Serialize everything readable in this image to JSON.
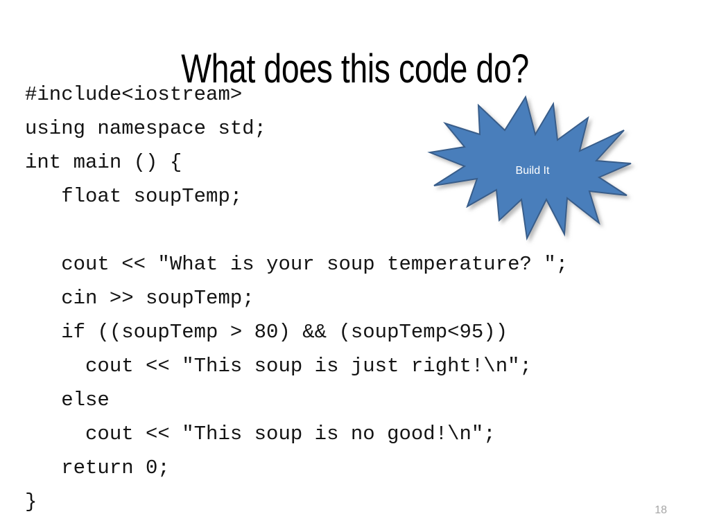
{
  "slide": {
    "title": "What does this code do?",
    "page_number": "18",
    "background_color": "#ffffff"
  },
  "code": {
    "language": "cpp",
    "text_color": "#141414",
    "lines": [
      "#include<iostream>",
      "using namespace std;",
      "int main () {",
      "   float soupTemp;",
      "",
      "   cout << \"What is your soup temperature? \";",
      "   cin >> soupTemp;",
      "   if ((soupTemp > 80) && (soupTemp<95))",
      "     cout << \"This soup is just right!\\n\";",
      "   else",
      "     cout << \"This soup is no good!\\n\";",
      "   return 0;",
      "}"
    ]
  },
  "callout": {
    "shape": "explosion-starburst",
    "label": "Build It",
    "fill_color": "#4a7ebb",
    "stroke_color": "#385d8a",
    "label_color": "#ffffff"
  }
}
